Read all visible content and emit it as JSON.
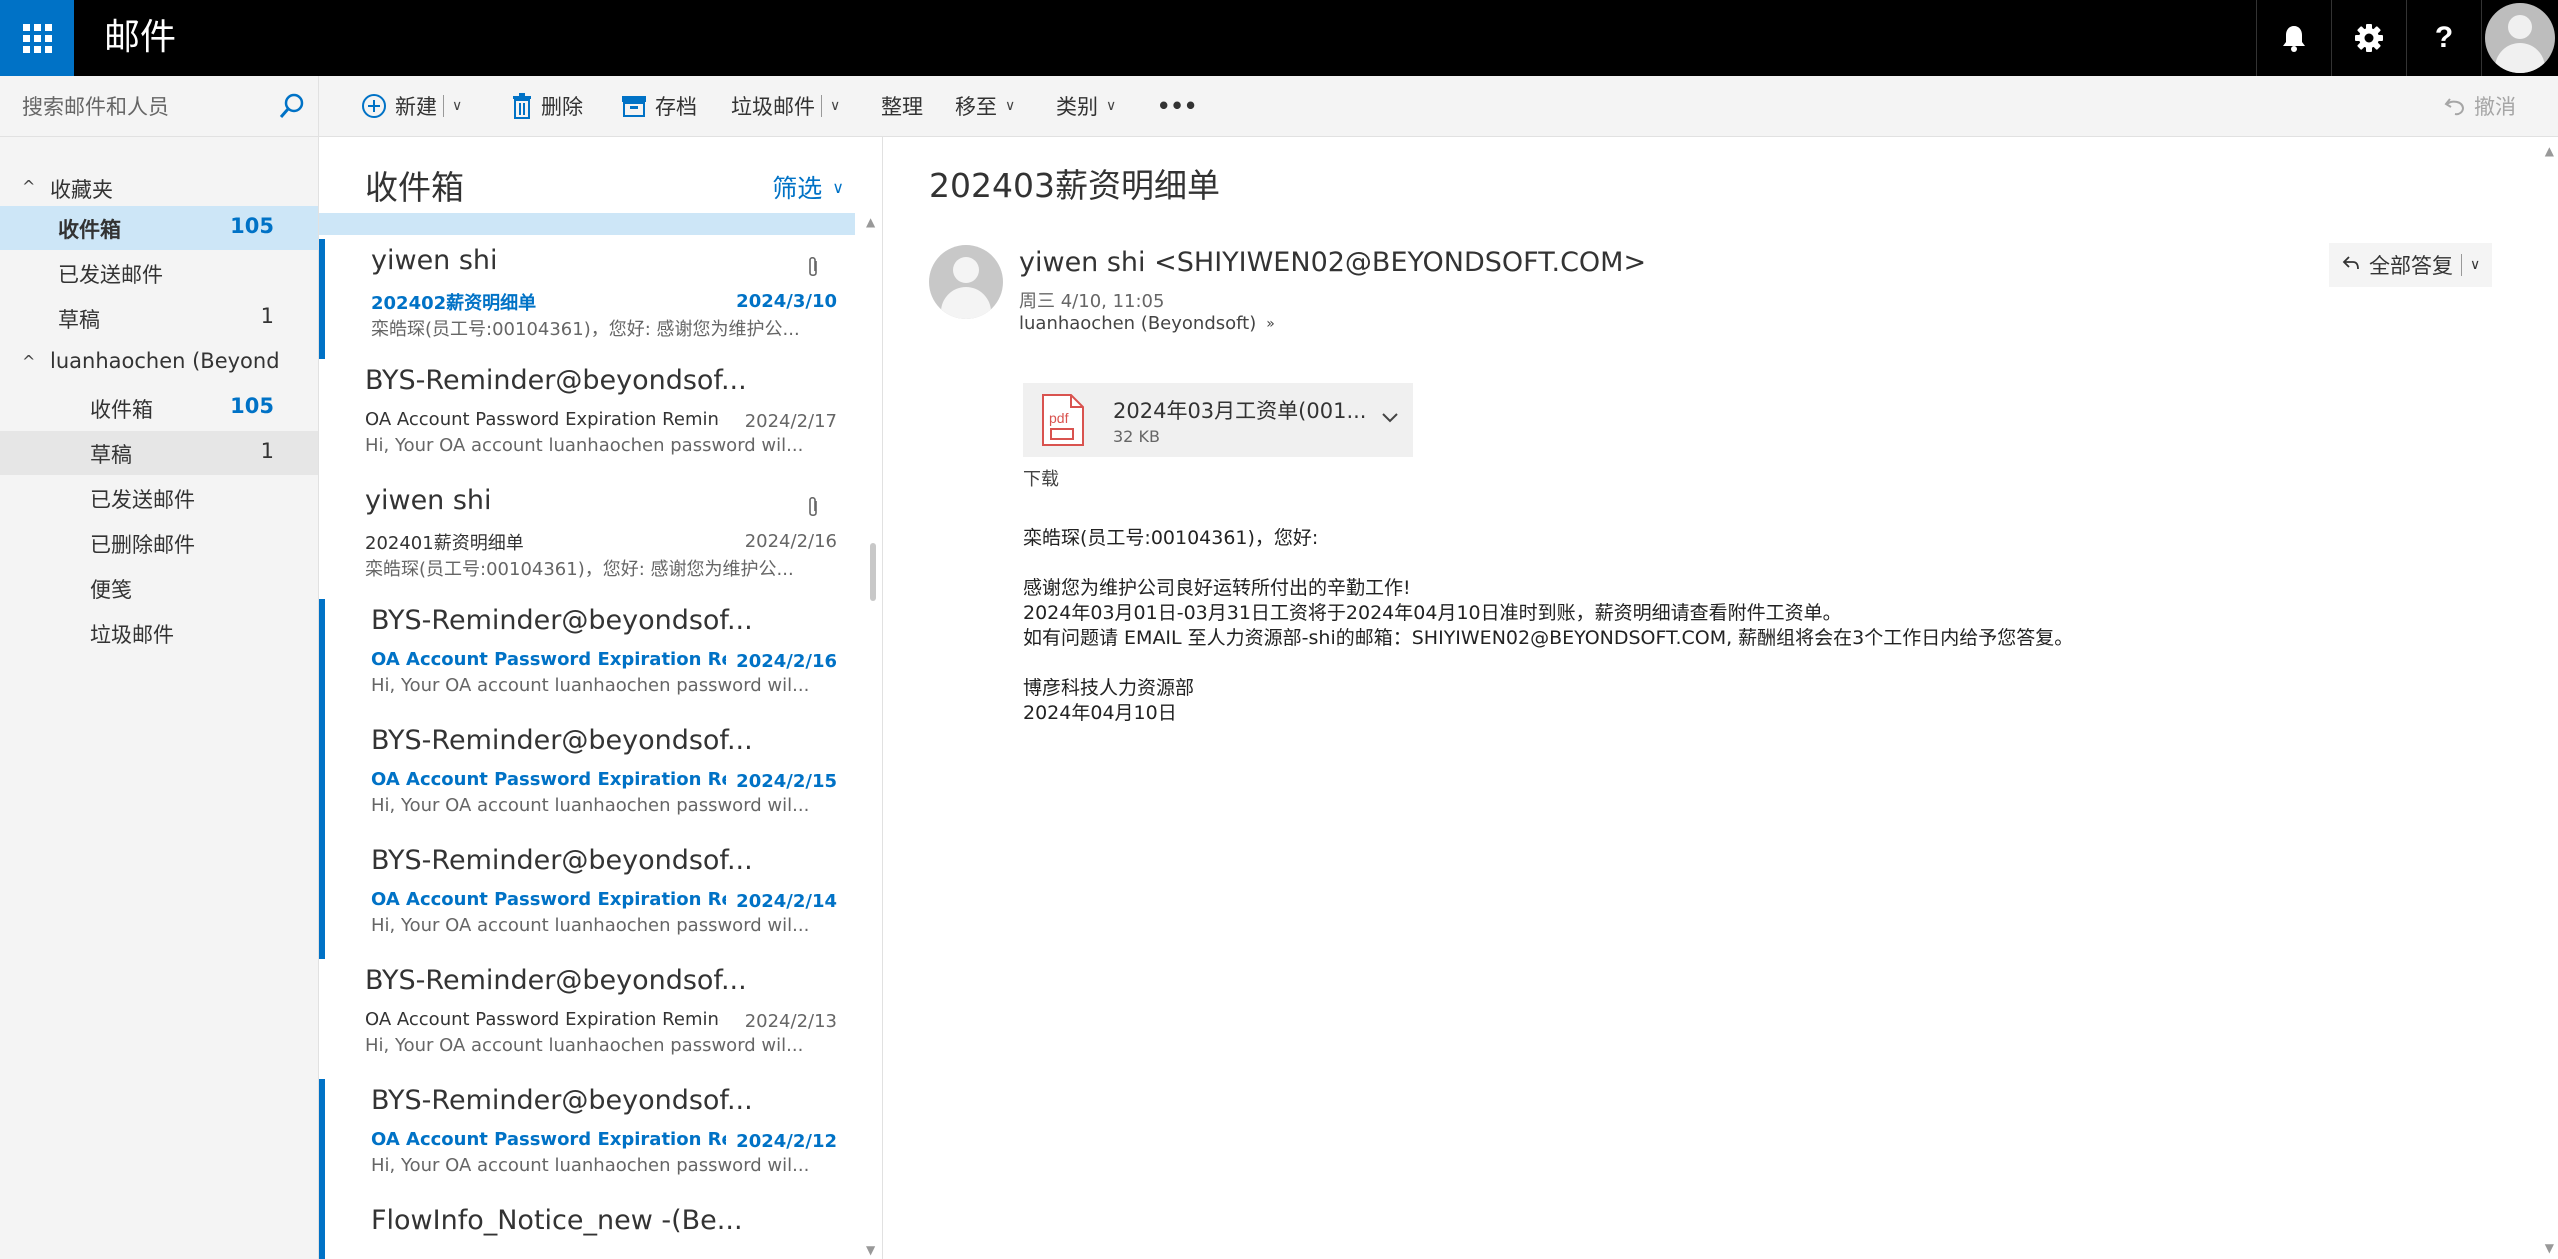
{
  "app": {
    "title": "邮件"
  },
  "search": {
    "placeholder": "搜索邮件和人员"
  },
  "nav": {
    "favorites_label": "收藏夹",
    "favorites": [
      {
        "label": "收件箱",
        "count": "105"
      },
      {
        "label": "已发送邮件",
        "count": ""
      },
      {
        "label": "草稿",
        "count": "1"
      }
    ],
    "account_label": "luanhaochen (Beyondsoft)",
    "folders": [
      {
        "label": "收件箱",
        "count": "105"
      },
      {
        "label": "草稿",
        "count": "1"
      },
      {
        "label": "已发送邮件",
        "count": ""
      },
      {
        "label": "已删除邮件",
        "count": ""
      },
      {
        "label": "便笺",
        "count": ""
      },
      {
        "label": "垃圾邮件",
        "count": ""
      }
    ]
  },
  "toolbar": {
    "new": "新建",
    "delete": "删除",
    "archive": "存档",
    "junk": "垃圾邮件",
    "sweep": "整理",
    "move": "移至",
    "categories": "类别",
    "more": "•••",
    "undo": "撤消"
  },
  "list": {
    "title": "收件箱",
    "filter": "筛选",
    "messages": [
      {
        "from": "yiwen shi",
        "subject": "202402薪资明细单",
        "date": "2024/3/10",
        "preview": "栾皓琛(员工号:00104361)，您好: 感谢您为维护公...",
        "unread": true,
        "attachment": true
      },
      {
        "from": "BYS-Reminder@beyondsof...",
        "subject": "OA Account Password Expiration Reminder",
        "date": "2024/2/17",
        "preview": "Hi, Your OA account luanhaochen password wil...",
        "unread": false,
        "attachment": false
      },
      {
        "from": "yiwen shi",
        "subject": "202401薪资明细单",
        "date": "2024/2/16",
        "preview": "栾皓琛(员工号:00104361)，您好: 感谢您为维护公...",
        "unread": false,
        "attachment": true
      },
      {
        "from": "BYS-Reminder@beyondsof...",
        "subject": "OA Account Password Expiration Reminder",
        "date": "2024/2/16",
        "preview": "Hi, Your OA account luanhaochen password wil...",
        "unread": true,
        "attachment": false
      },
      {
        "from": "BYS-Reminder@beyondsof...",
        "subject": "OA Account Password Expiration Reminder",
        "date": "2024/2/15",
        "preview": "Hi, Your OA account luanhaochen password wil...",
        "unread": true,
        "attachment": false
      },
      {
        "from": "BYS-Reminder@beyondsof...",
        "subject": "OA Account Password Expiration Reminder",
        "date": "2024/2/14",
        "preview": "Hi, Your OA account luanhaochen password wil...",
        "unread": true,
        "attachment": false
      },
      {
        "from": "BYS-Reminder@beyondsof...",
        "subject": "OA Account Password Expiration Reminder",
        "date": "2024/2/13",
        "preview": "Hi, Your OA account luanhaochen password wil...",
        "unread": false,
        "attachment": false
      },
      {
        "from": "BYS-Reminder@beyondsof...",
        "subject": "OA Account Password Expiration Reminder",
        "date": "2024/2/12",
        "preview": "Hi, Your OA account luanhaochen password wil...",
        "unread": true,
        "attachment": false
      },
      {
        "from": "FlowInfo_Notice_new -(Be...",
        "subject": "",
        "date": "",
        "preview": "",
        "unread": true,
        "attachment": false
      }
    ]
  },
  "reading": {
    "subject": "202403薪资明细单",
    "from": "yiwen shi <SHIYIWEN02@BEYONDSOFT.COM>",
    "date": "周三 4/10, 11:05",
    "to": "luanhaochen (Beyondsoft)",
    "reply_all": "全部答复",
    "attachment": {
      "name": "2024年03月工资单(001...",
      "size": "32 KB",
      "type": "pdf"
    },
    "download": "下载",
    "body": [
      "栾皓琛(员工号:00104361)，您好:",
      "",
      "感谢您为维护公司良好运转所付出的辛勤工作!",
      "2024年03月01日-03月31日工资将于2024年04月10日准时到账，薪资明细请查看附件工资单。",
      "如有问题请 EMAIL 至人力资源部-shi的邮箱：SHIYIWEN02@BEYONDSOFT.COM, 薪酬组将会在3个工作日内给予您答复。",
      "",
      "博彦科技人力资源部",
      "2024年04月10日"
    ]
  },
  "colors": {
    "accent": "#0072c6",
    "topbar": "#000000",
    "selected": "#cde6f7"
  }
}
